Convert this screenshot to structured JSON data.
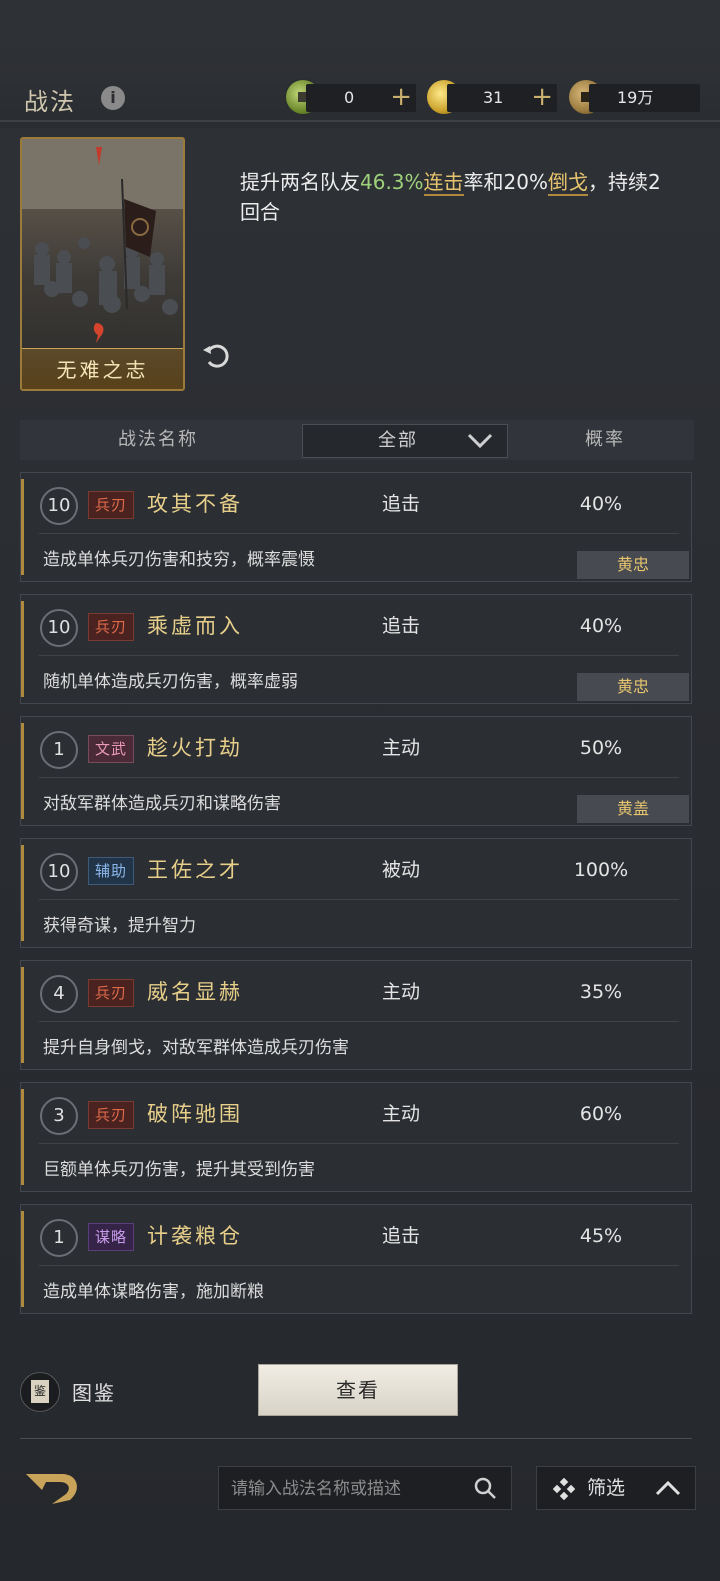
{
  "header": {
    "title": "战法",
    "resources": [
      {
        "icon": "jade-coin-icon",
        "value": "0",
        "has_plus": true
      },
      {
        "icon": "gold-coin-icon",
        "value": "31",
        "has_plus": true
      },
      {
        "icon": "copper-coin-icon",
        "value": "19万",
        "has_plus": false
      }
    ]
  },
  "featured": {
    "card_name": "无难之志",
    "description_parts": [
      {
        "text": "提升两名队友",
        "style": "normal"
      },
      {
        "text": "46.3%",
        "style": "green"
      },
      {
        "text": "连击",
        "style": "keyword"
      },
      {
        "text": "率和20%",
        "style": "normal"
      },
      {
        "text": "倒戈",
        "style": "keyword"
      },
      {
        "text": "，持续2回合",
        "style": "normal"
      }
    ]
  },
  "table_header": {
    "name_col": "战法名称",
    "filter_value": "全部",
    "prob_col": "概率"
  },
  "tactics": [
    {
      "level": "10",
      "tag": "兵刃",
      "tag_type": "bing",
      "name": "攻其不备",
      "type": "追击",
      "prob": "40%",
      "desc": "造成单体兵刃伤害和技穷，概率震慑",
      "hero": "黄忠"
    },
    {
      "level": "10",
      "tag": "兵刃",
      "tag_type": "bing",
      "name": "乘虚而入",
      "type": "追击",
      "prob": "40%",
      "desc": "随机单体造成兵刃伤害，概率虚弱",
      "hero": "黄忠"
    },
    {
      "level": "1",
      "tag": "文武",
      "tag_type": "wenwu",
      "name": "趁火打劫",
      "type": "主动",
      "prob": "50%",
      "desc": "对敌军群体造成兵刃和谋略伤害",
      "hero": "黄盖"
    },
    {
      "level": "10",
      "tag": "辅助",
      "tag_type": "fuzhu",
      "name": "王佐之才",
      "type": "被动",
      "prob": "100%",
      "desc": "获得奇谋，提升智力",
      "hero": ""
    },
    {
      "level": "4",
      "tag": "兵刃",
      "tag_type": "bing",
      "name": "威名显赫",
      "type": "主动",
      "prob": "35%",
      "desc": "提升自身倒戈，对敌军群体造成兵刃伤害",
      "hero": ""
    },
    {
      "level": "3",
      "tag": "兵刃",
      "tag_type": "bing",
      "name": "破阵驰围",
      "type": "主动",
      "prob": "60%",
      "desc": "巨额单体兵刃伤害，提升其受到伤害",
      "hero": ""
    },
    {
      "level": "1",
      "tag": "谋略",
      "tag_type": "moulue",
      "name": "计袭粮仓",
      "type": "追击",
      "prob": "45%",
      "desc": "造成单体谋略伤害，施加断粮",
      "hero": ""
    }
  ],
  "footer": {
    "codex_label": "图鉴",
    "codex_icon_text": "鉴",
    "view_label": "查看",
    "search_placeholder": "请输入战法名称或描述",
    "filter_label": "筛选"
  }
}
